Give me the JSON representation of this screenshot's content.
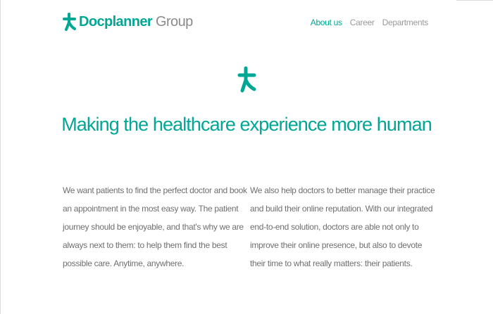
{
  "brand": {
    "name": "Docplanner",
    "suffix": "Group",
    "color": "#00a794",
    "logo_icon": "docplanner-star-icon"
  },
  "nav": {
    "items": [
      {
        "label": "About us",
        "active": true
      },
      {
        "label": "Career",
        "active": false
      },
      {
        "label": "Departments",
        "active": false
      }
    ]
  },
  "hero": {
    "icon": "docplanner-star-icon",
    "headline": "Making the healthcare experience more human"
  },
  "content": {
    "left_paragraph": "We want patients to find the perfect doctor and book an appointment in the most easy way. The patient journey should be enjoyable, and that's why we are always next to them: to help them find the best possible care. Anytime, anywhere.",
    "right_paragraph": "We also help doctors to better manage their practice and build their online reputation. With our integrated end-to-end solution, doctors are able not only to improve their online presence, but also to devote their time to what really matters: their patients."
  }
}
